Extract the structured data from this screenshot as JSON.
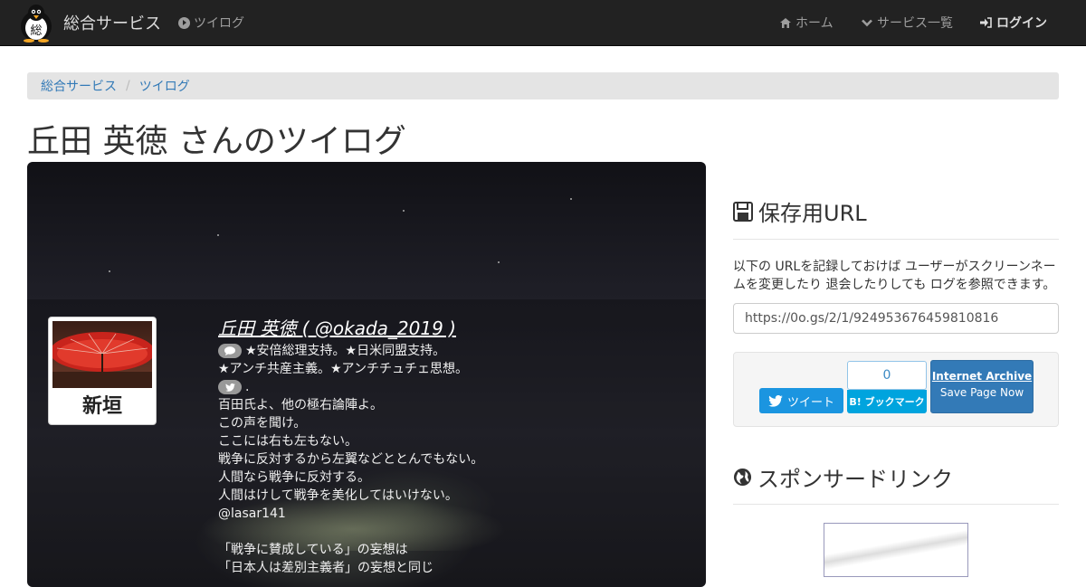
{
  "navbar": {
    "brand": "総合サービス",
    "brand_logo_char": "総",
    "tsuilog": "ツイログ",
    "home": "ホーム",
    "services": "サービス一覧",
    "login": "ログイン"
  },
  "breadcrumb": {
    "items": [
      "総合サービス",
      "ツイログ"
    ],
    "separator": "/"
  },
  "page_title": "丘田 英徳 さんのツイログ",
  "profile": {
    "avatar_name": "新垣",
    "name_line": "丘田 英徳 ( @okada_2019 )",
    "description": "★安倍総理支持。★日米同盟支持。",
    "description_2": "★アンチ共産主義。★アンチチュチェ思想。",
    "tweet_marker": ".",
    "bio_lines": [
      "百田氏よ、他の極右論陣よ。",
      "この声を聞け。",
      "ここには右も左もない。",
      "戦争に反対するから左翼などととんでもない。",
      "人間なら戦争に反対する。",
      "人間はけして戦争を美化してはいけない。",
      "@lasar141",
      "",
      "「戦争に賛成している」の妄想は",
      "「日本人は差別主義者」の妄想と同じ"
    ]
  },
  "save_panel": {
    "title": "保存用URL",
    "description": "以下の URLを記録しておけば ユーザーがスクリーンネームを変更したり 退会したりしても ログを参照できます。",
    "url": "https://0o.gs/2/1/924953676459810816"
  },
  "share": {
    "tweet": "ツイート",
    "hatena_count": "0",
    "hatena_label": "B! ブックマーク",
    "ia_title": "Internet Archive",
    "ia_sub": "Save Page Now"
  },
  "sponsor_panel": {
    "title": "スポンサードリンク"
  },
  "colors": {
    "navbar": "#222222",
    "link": "#337ab7",
    "twitter": "#1b95e0",
    "hatena": "#00a4de"
  }
}
